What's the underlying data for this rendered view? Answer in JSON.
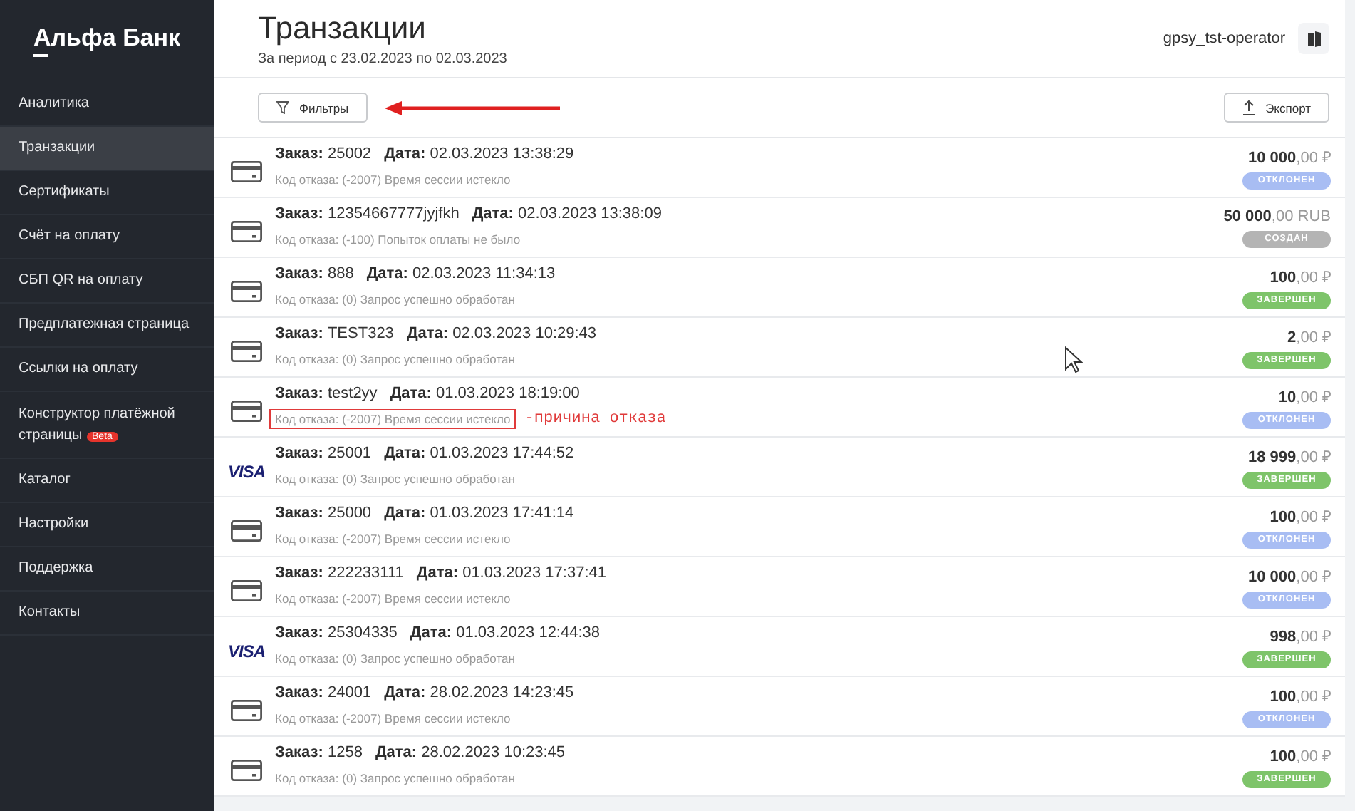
{
  "sidebar": {
    "logo": "Альфа Банк",
    "items": [
      {
        "label": "Аналитика",
        "selected": false
      },
      {
        "label": "Транзакции",
        "selected": true
      },
      {
        "label": "Сертификаты",
        "selected": false
      },
      {
        "label": "Счёт на оплату",
        "selected": false
      },
      {
        "label": "СБП QR на оплату",
        "selected": false
      },
      {
        "label": "Предплатежная страница",
        "selected": false
      },
      {
        "label": "Ссылки на оплату",
        "selected": false
      },
      {
        "label": "Конструктор платёжной страницы",
        "selected": false,
        "badge": "Beta"
      },
      {
        "label": "Каталог",
        "selected": false
      },
      {
        "label": "Настройки",
        "selected": false
      },
      {
        "label": "Поддержка",
        "selected": false
      },
      {
        "label": "Контакты",
        "selected": false
      }
    ]
  },
  "header": {
    "title": "Транзакции",
    "period": "За период с 23.02.2023 по 02.03.2023",
    "user": "gpsy_tst-operator"
  },
  "toolbar": {
    "filters": "Фильтры",
    "export": "Экспорт",
    "filter_arrow": true
  },
  "transactions": [
    {
      "payment": {
        "kind": "card"
      },
      "order": "**Заказ:** 25002",
      "date": "**Дата:** 02.03.2023 13:38:29",
      "reason": "Код отказа: (-2007) Время сессии истекло",
      "highlighted": false,
      "amount": "**10 000**,00 ₽",
      "status": {
        "label": "ОТКЛОНЕН",
        "kind": "declined"
      }
    },
    {
      "payment": {
        "kind": "card"
      },
      "order": "**Заказ:** 12354667777jyjfkh",
      "date": "**Дата:** 02.03.2023 13:38:09",
      "reason": "Код отказа: (-100) Попыток оплаты не было",
      "highlighted": false,
      "amount": "**50 000**,00 RUB",
      "status": {
        "label": "СОЗДАН",
        "kind": "created"
      }
    },
    {
      "payment": {
        "kind": "card"
      },
      "order": "**Заказ:** 888",
      "date": "**Дата:** 02.03.2023 11:34:13",
      "reason": "Код отказа: (0) Запрос успешно обработан",
      "highlighted": false,
      "amount": "**100**,00 ₽",
      "status": {
        "label": "ЗАВЕРШЕН",
        "kind": "completed"
      }
    },
    {
      "payment": {
        "kind": "card"
      },
      "order": "**Заказ:** TEST323",
      "date": "**Дата:** 02.03.2023 10:29:43",
      "reason": "Код отказа: (0) Запрос успешно обработан",
      "highlighted": false,
      "amount": "**2**,00 ₽",
      "status": {
        "label": "ЗАВЕРШЕН",
        "kind": "completed"
      }
    },
    {
      "payment": {
        "kind": "card"
      },
      "order": "**Заказ:** test2yy",
      "date": "**Дата:** 01.03.2023 18:19:00",
      "reason": "Код отказа: (-2007) Время сессии истекло",
      "highlighted": true,
      "annotation": "-причина отказа",
      "amount": "**10**,00 ₽",
      "status": {
        "label": "ОТКЛОНЕН",
        "kind": "declined"
      }
    },
    {
      "payment": {
        "kind": "visa",
        "label": "VISA"
      },
      "order": "**Заказ:** 25001",
      "date": "**Дата:** 01.03.2023 17:44:52",
      "reason": "Код отказа: (0) Запрос успешно обработан",
      "highlighted": false,
      "amount": "**18 999**,00 ₽",
      "status": {
        "label": "ЗАВЕРШЕН",
        "kind": "completed"
      }
    },
    {
      "payment": {
        "kind": "card"
      },
      "order": "**Заказ:** 25000",
      "date": "**Дата:** 01.03.2023 17:41:14",
      "reason": "Код отказа: (-2007) Время сессии истекло",
      "highlighted": false,
      "amount": "**100**,00 ₽",
      "status": {
        "label": "ОТКЛОНЕН",
        "kind": "declined"
      }
    },
    {
      "payment": {
        "kind": "card"
      },
      "order": "**Заказ:** 222233111",
      "date": "**Дата:** 01.03.2023 17:37:41",
      "reason": "Код отказа: (-2007) Время сессии истекло",
      "highlighted": false,
      "amount": "**10 000**,00 ₽",
      "status": {
        "label": "ОТКЛОНЕН",
        "kind": "declined"
      }
    },
    {
      "payment": {
        "kind": "visa",
        "label": "VISA"
      },
      "order": "**Заказ:** 25304335",
      "date": "**Дата:** 01.03.2023 12:44:38",
      "reason": "Код отказа: (0) Запрос успешно обработан",
      "highlighted": false,
      "amount": "**998**,00 ₽",
      "status": {
        "label": "ЗАВЕРШЕН",
        "kind": "completed"
      }
    },
    {
      "payment": {
        "kind": "card"
      },
      "order": "**Заказ:** 24001",
      "date": "**Дата:** 28.02.2023 14:23:45",
      "reason": "Код отказа: (-2007) Время сессии истекло",
      "highlighted": false,
      "amount": "**100**,00 ₽",
      "status": {
        "label": "ОТКЛОНЕН",
        "kind": "declined"
      }
    },
    {
      "payment": {
        "kind": "card"
      },
      "order": "**Заказ:** 1258",
      "date": "**Дата:** 28.02.2023 10:23:45",
      "reason": "Код отказа: (0) Запрос успешно обработан",
      "highlighted": false,
      "amount": "**100**,00 ₽",
      "status": {
        "label": "ЗАВЕРШЕН",
        "kind": "completed"
      }
    }
  ]
}
